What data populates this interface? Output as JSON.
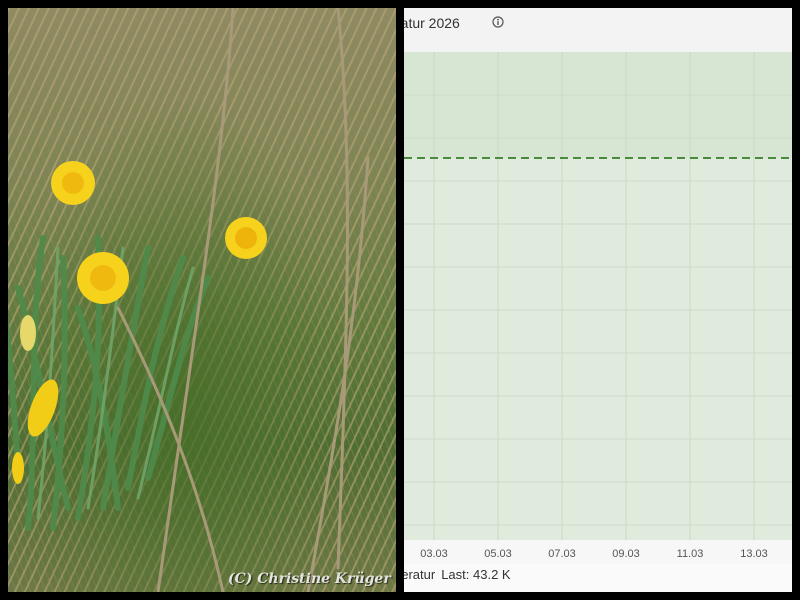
{
  "photo": {
    "watermark": "(C) Christine Krüger"
  },
  "chart": {
    "title": "ratur 2026",
    "legend_label": "peratur",
    "legend_last_label": "Last:",
    "legend_last_value": "43.2 K",
    "colors": {
      "threshold_line": "#4a8a3c",
      "band_upper": "#d7e6d3",
      "band_lower": "#e0ebde"
    }
  },
  "chart_data": {
    "type": "line",
    "x_tick_labels": [
      "03.03",
      "05.03",
      "07.03",
      "09.03",
      "11.03",
      "13.03"
    ],
    "series": [],
    "threshold": {
      "style": "dashed"
    },
    "grid": true
  }
}
